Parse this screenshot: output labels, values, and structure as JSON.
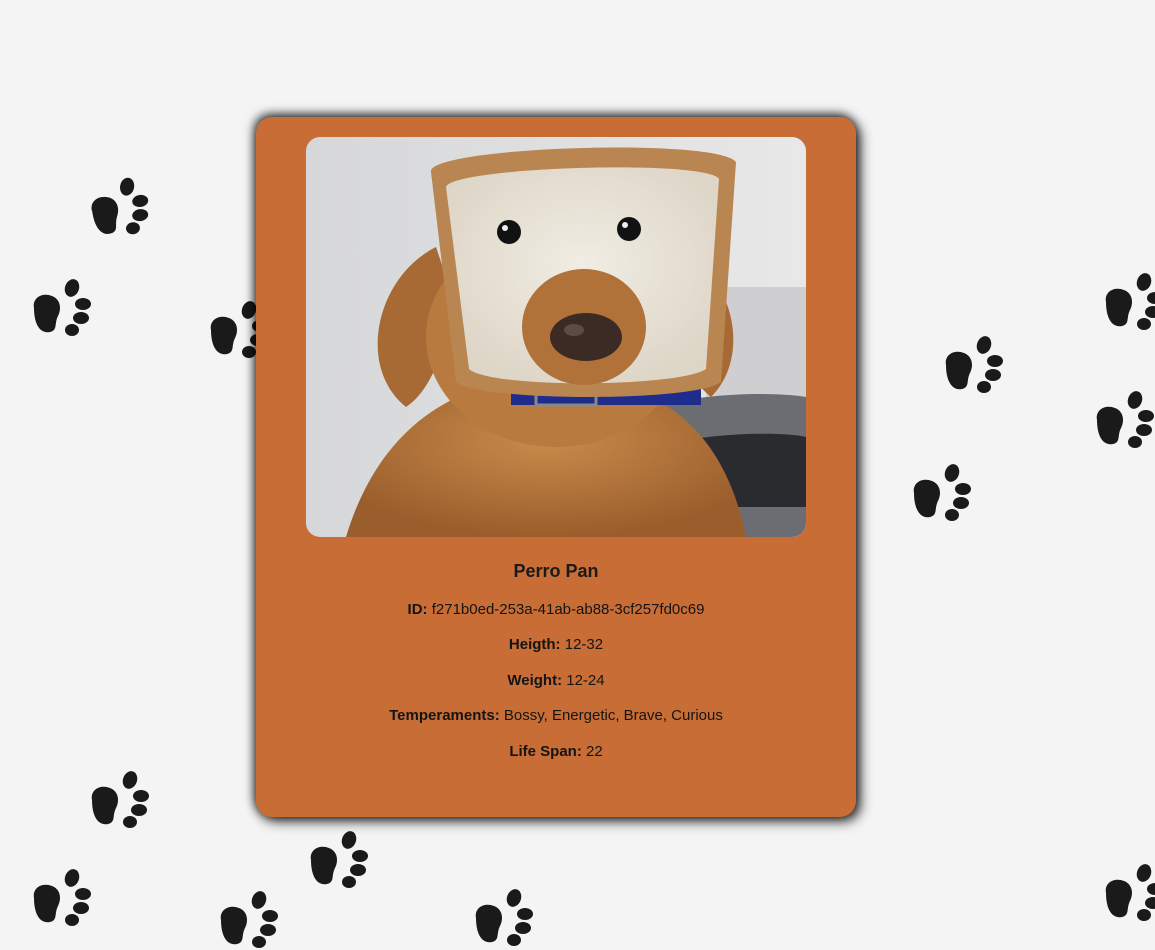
{
  "breed": {
    "name": "Perro Pan",
    "fields": {
      "id": {
        "label": "ID:",
        "value": "f271b0ed-253a-41ab-ab88-3cf257fd0c69"
      },
      "height": {
        "label": "Heigth:",
        "value": "12-32"
      },
      "weight": {
        "label": "Weight:",
        "value": "12-24"
      },
      "temperaments": {
        "label": "Temperaments:",
        "value": "Bossy, Energetic, Brave, Curious"
      },
      "life_span": {
        "label": "Life Span:",
        "value": "22"
      }
    }
  },
  "background": {
    "color": "#f4f4f4",
    "pattern_icon": "paw-print-icon",
    "pattern_color": "#1a1a1a"
  },
  "card": {
    "color": "#c86d35",
    "image_icon": "dog-photo"
  }
}
